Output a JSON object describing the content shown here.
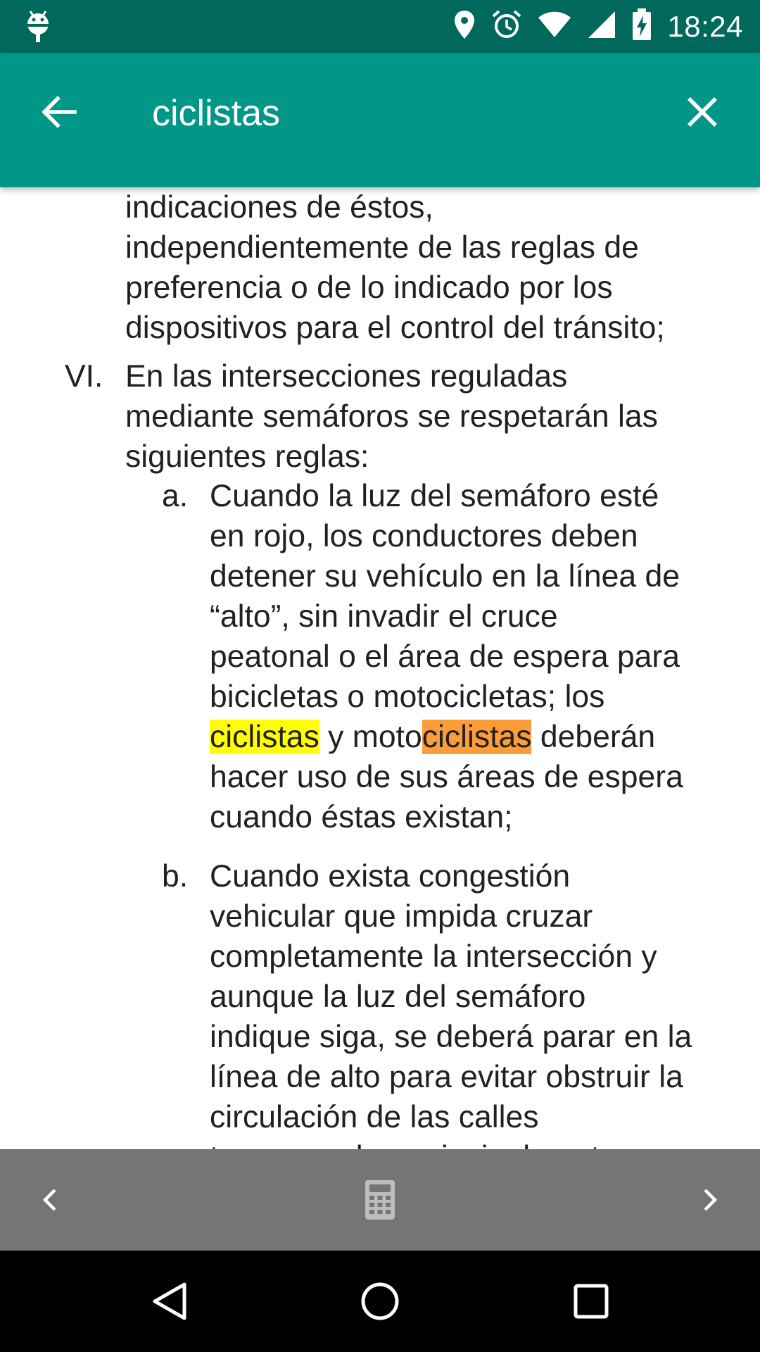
{
  "status_bar": {
    "time": "18:24",
    "icons": [
      "android-debug-icon",
      "location-icon",
      "alarm-icon",
      "wifi-icon",
      "signal-icon",
      "battery-charging-icon"
    ]
  },
  "search_bar": {
    "query": "ciclistas",
    "back_icon": "arrow-back-icon",
    "clear_icon": "close-icon",
    "colors": {
      "status": "#00695c",
      "toolbar": "#009688"
    }
  },
  "document": {
    "top_lines": [
      "indicaciones de éstos,",
      "independientemente de las reglas de",
      "preferencia o de lo indicado por los",
      "dispositivos para el control del tránsito;"
    ],
    "item_vi": {
      "marker": "VI.",
      "lines": [
        "En las intersecciones reguladas",
        "mediante semáforos se respetarán las",
        "siguientes reglas:"
      ]
    },
    "item_a": {
      "marker": "a.",
      "lines": [
        "Cuando la luz del semáforo esté",
        "en rojo, los conductores deben",
        "detener su vehículo en la línea de",
        "“alto”, sin invadir el cruce",
        "peatonal o el área de espera para",
        "bicicletas o motocicletas; los"
      ],
      "hl_line": {
        "match_current": "ciclistas",
        "mid": " y moto",
        "match_other": "ciclistas",
        "tail": " deberán"
      },
      "lines_after": [
        "hacer uso de sus áreas de espera",
        "cuando éstas existan;"
      ]
    },
    "item_b": {
      "marker": "b.",
      "lines": [
        "Cuando exista congestión",
        "vehicular que impida cruzar",
        "completamente la intersección y",
        "aunque la luz del semáforo",
        "indique siga, se deberá parar en la",
        "línea de alto para evitar obstruir la",
        "circulación de las calles",
        "transversales, principalmente en"
      ]
    },
    "highlight_colors": {
      "current": "#ffff00",
      "other": "#ff9c3a"
    }
  },
  "search_nav": {
    "prev_icon": "chevron-left-icon",
    "calc_icon": "calculator-icon",
    "next_icon": "chevron-right-icon"
  },
  "system_nav": {
    "back_icon": "nav-back-icon",
    "home_icon": "nav-home-icon",
    "recents_icon": "nav-recents-icon"
  }
}
